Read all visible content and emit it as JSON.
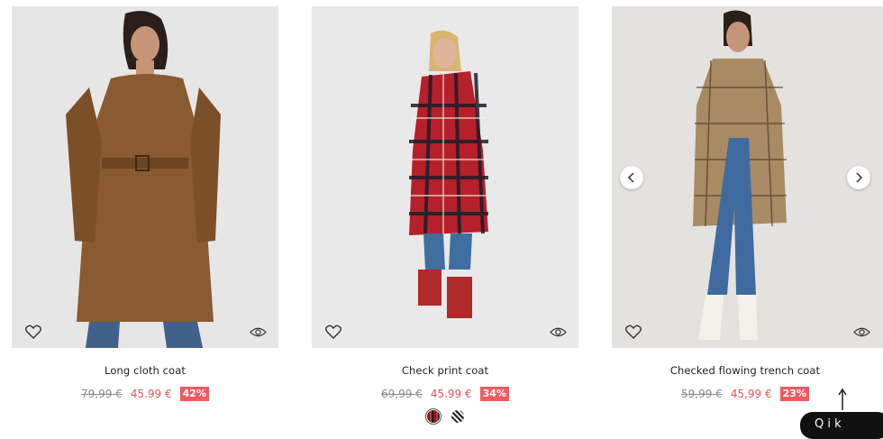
{
  "products": [
    {
      "name": "Long cloth coat",
      "old_price": "79,99 €",
      "new_price": "45.99 €",
      "discount": "42%"
    },
    {
      "name": "Check print coat",
      "old_price": "69,99 €",
      "new_price": "45.99 €",
      "discount": "34%"
    },
    {
      "name": "Checked flowing trench coat",
      "old_price": "59,99 €",
      "new_price": "45,99 €",
      "discount": "23%"
    }
  ],
  "quick_button": {
    "label": "Q  i  k"
  },
  "colors": {
    "price_red": "#e5545a",
    "discount_bg": "#ef5a60"
  }
}
